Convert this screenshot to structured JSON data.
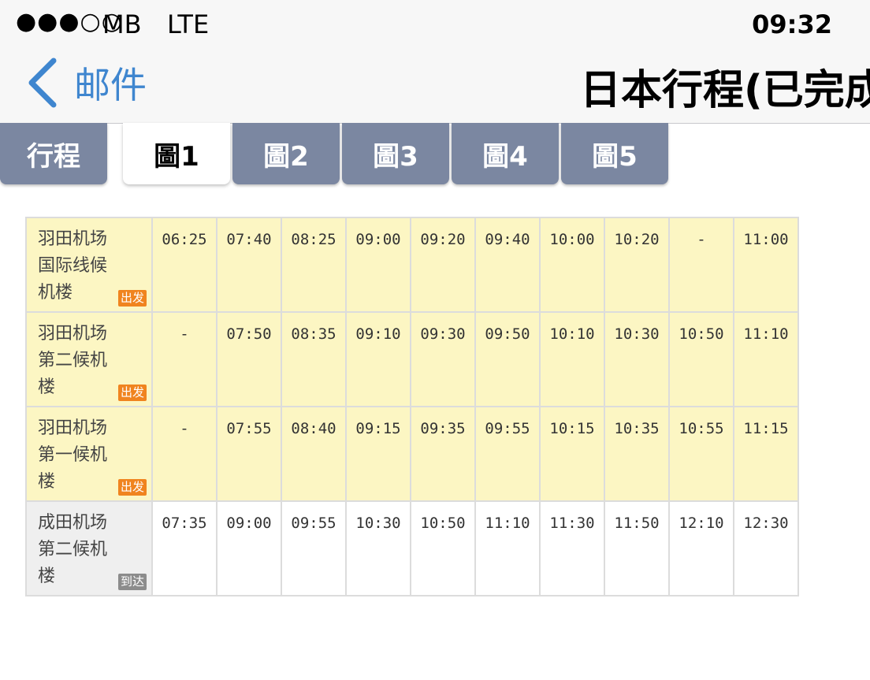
{
  "status_bar": {
    "signal": "●●●○○",
    "carrier": "MB",
    "network": "LTE",
    "time": "09:32"
  },
  "nav": {
    "back_label": "邮件",
    "title": "日本行程(已完成"
  },
  "tabs": [
    {
      "label": "行程"
    },
    {
      "label": "圖1"
    },
    {
      "label": "圖2"
    },
    {
      "label": "圖3"
    },
    {
      "label": "圖4"
    },
    {
      "label": "圖5"
    }
  ],
  "active_tab": "圖1",
  "schedule": {
    "rows": [
      {
        "station": "羽田机场国际线候机楼",
        "badge": "出发",
        "times": [
          "06:25",
          "07:40",
          "08:25",
          "09:00",
          "09:20",
          "09:40",
          "10:00",
          "10:20",
          "-",
          "11:00"
        ]
      },
      {
        "station": "羽田机场第二候机楼",
        "badge": "出发",
        "times": [
          "-",
          "07:50",
          "08:35",
          "09:10",
          "09:30",
          "09:50",
          "10:10",
          "10:30",
          "10:50",
          "11:10"
        ]
      },
      {
        "station": "羽田机场第一候机楼",
        "badge": "出发",
        "times": [
          "-",
          "07:55",
          "08:40",
          "09:15",
          "09:35",
          "09:55",
          "10:15",
          "10:35",
          "10:55",
          "11:15"
        ]
      },
      {
        "station": "成田机场第二候机楼",
        "badge": "到达",
        "times": [
          "07:35",
          "09:00",
          "09:55",
          "10:30",
          "10:50",
          "11:10",
          "11:30",
          "11:50",
          "12:10",
          "12:30"
        ]
      }
    ]
  },
  "colors": {
    "accent": "#3f86cf",
    "tab_bg": "#7b87a1",
    "departure_row_bg": "#fcf6c3",
    "departure_badge": "#f0841f",
    "arrival_badge": "#8c8c8c"
  }
}
